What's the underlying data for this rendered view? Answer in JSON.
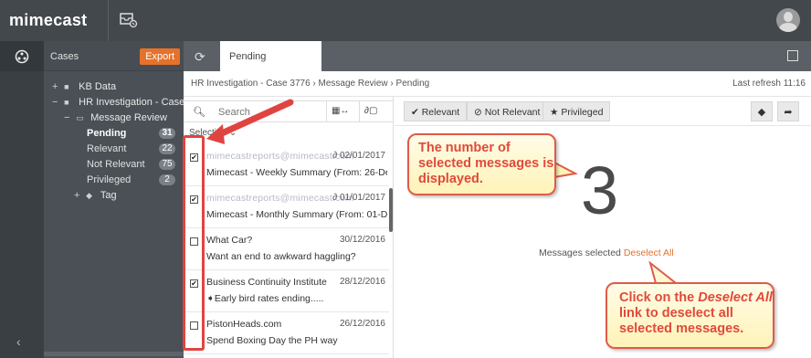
{
  "app": {
    "logo": "mimecast"
  },
  "cases": {
    "title": "Cases",
    "export_label": "Export",
    "tree": [
      {
        "label": "KB Data"
      },
      {
        "label": "HR Investigation - Case 37"
      },
      {
        "label": "Message Review"
      }
    ],
    "folders": [
      {
        "label": "Pending",
        "count": "31"
      },
      {
        "label": "Relevant",
        "count": "22"
      },
      {
        "label": "Not Relevant",
        "count": "75"
      },
      {
        "label": "Privileged",
        "count": "2"
      }
    ],
    "tag_label": "Tag"
  },
  "tab": {
    "label": "Pending"
  },
  "breadcrumb": {
    "path": "HR Investigation - Case 3776 › Message Review › Pending",
    "last_refresh": "Last refresh 11:16"
  },
  "list": {
    "search_placeholder": "Search",
    "selection_label": "Selection",
    "messages": [
      {
        "from": "mimecastreports@mimecast.com",
        "date": "02/01/2017",
        "subject": "Mimecast - Weekly Summary (From: 26-De...",
        "checked": true,
        "attachment": true,
        "from_blurred": true
      },
      {
        "from": "mimecastreports@mimecast.com",
        "date": "01/01/2017",
        "subject": "Mimecast - Monthly Summary (From: 01-De...",
        "checked": true,
        "attachment": true,
        "from_blurred": true
      },
      {
        "from": "What Car?",
        "date": "30/12/2016",
        "subject": "Want an end to awkward haggling?",
        "checked": false
      },
      {
        "from": "Business Continuity Institute",
        "date": "28/12/2016",
        "subject": "Early bird rates ending.....",
        "checked": true
      },
      {
        "from": "PistonHeads.com",
        "date": "26/12/2016",
        "subject": "Spend Boxing Day the PH way",
        "checked": false
      }
    ]
  },
  "actions": {
    "relevant": "Relevant",
    "not_relevant": "Not Relevant",
    "privileged": "Privileged"
  },
  "detail": {
    "selected_count": "3",
    "selected_label": "Messages selected",
    "deselect_label": "Deselect All"
  },
  "callouts": {
    "count_note": "The number of selected messages is displayed.",
    "deselect_note_pre": "Click on the",
    "deselect_note_em": "Deselect All",
    "deselect_note_post": "link to deselect all selected messages."
  },
  "colors": {
    "accent": "#e5722b",
    "callout_text": "#e04a3a",
    "topbar": "#43484d"
  }
}
